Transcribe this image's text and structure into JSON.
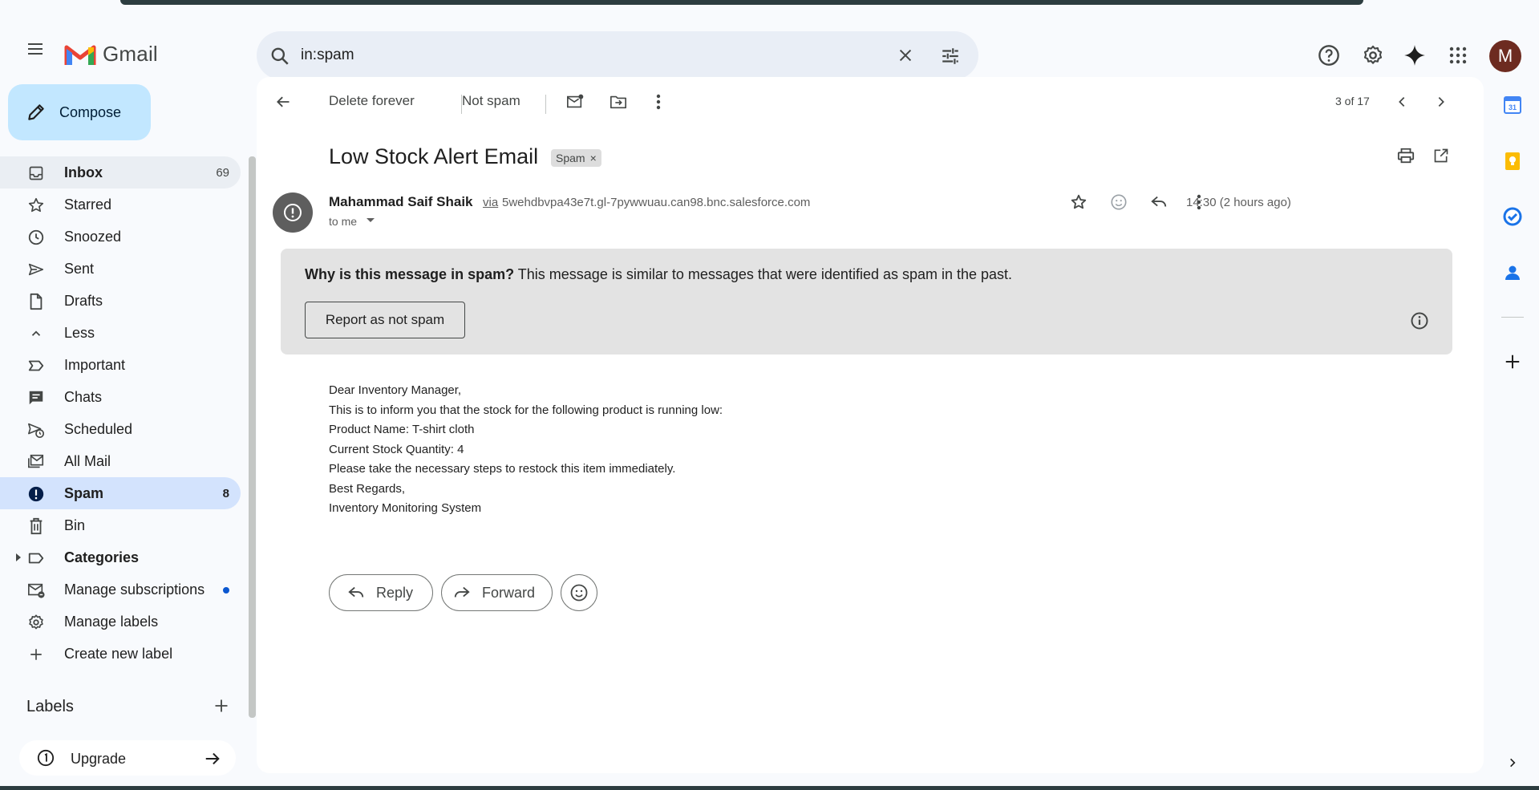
{
  "app": {
    "name": "Gmail"
  },
  "search": {
    "value": "in:spam"
  },
  "compose": {
    "label": "Compose"
  },
  "sidebar": {
    "items": [
      {
        "label": "Inbox",
        "count": "69",
        "bold": true
      },
      {
        "label": "Starred"
      },
      {
        "label": "Snoozed"
      },
      {
        "label": "Sent"
      },
      {
        "label": "Drafts"
      },
      {
        "label": "Less"
      },
      {
        "label": "Important"
      },
      {
        "label": "Chats"
      },
      {
        "label": "Scheduled"
      },
      {
        "label": "All Mail"
      },
      {
        "label": "Spam",
        "count": "8",
        "bold": true,
        "active": true
      },
      {
        "label": "Bin"
      },
      {
        "label": "Categories",
        "bold": true
      },
      {
        "label": "Manage subscriptions"
      },
      {
        "label": "Manage labels"
      },
      {
        "label": "Create new label"
      }
    ],
    "labels_header": "Labels",
    "upgrade": "Upgrade"
  },
  "toolbar": {
    "delete_forever": "Delete forever",
    "not_spam": "Not spam",
    "pagination": "3 of 17"
  },
  "email": {
    "subject": "Low Stock Alert Email",
    "chip": "Spam",
    "chip_close": "×",
    "sender_name": "Mahammad Saif Shaik",
    "via": "via",
    "sender_address": "5wehdbvpa43e7t.gl-7pywwuau.can98.bnc.salesforce.com",
    "to": "to me",
    "time": "14:30 (2 hours ago)",
    "avatar_initial": "M",
    "body": [
      "Dear Inventory Manager,",
      "This is to inform you that the stock for the following product is running low:",
      "Product Name: T-shirt cloth",
      "Current Stock Quantity: 4",
      "Please take the necessary steps to restock this item immediately.",
      "Best Regards,",
      "Inventory Monitoring System"
    ]
  },
  "spam_warning": {
    "question": "Why is this message in spam?",
    "explanation": "This message is similar to messages that were identified as spam in the past.",
    "report_button": "Report as not spam"
  },
  "actions": {
    "reply": "Reply",
    "forward": "Forward"
  },
  "colors": {
    "active_nav": "#d3e3fd",
    "compose_bg": "#c2e7ff",
    "accent": "#0b57d0"
  }
}
